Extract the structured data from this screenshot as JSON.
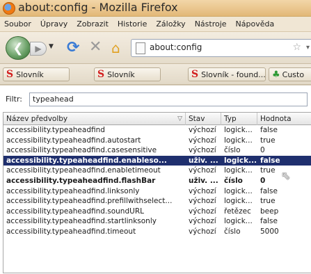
{
  "window": {
    "title": "about:config - Mozilla Firefox"
  },
  "menu": [
    "Soubor",
    "Úpravy",
    "Zobrazit",
    "Historie",
    "Záložky",
    "Nástroje",
    "Nápověda"
  ],
  "nav": {
    "url": "about:config"
  },
  "bookmarks": [
    {
      "label": "Slovník",
      "icon": "S"
    },
    {
      "label": "Slovník",
      "icon": "S"
    },
    {
      "label": "Slovník - found...",
      "icon": "S"
    },
    {
      "label": "Custo",
      "icon": "♣"
    }
  ],
  "filter": {
    "label": "Filtr:",
    "value": "typeahead"
  },
  "table": {
    "headers": [
      "Název předvolby",
      "Stav",
      "Typ",
      "Hodnota"
    ],
    "rows": [
      {
        "name": "accessibility.typeaheadfind",
        "status": "výchozí",
        "type": "logick...",
        "value": "false",
        "selected": false,
        "bold": false
      },
      {
        "name": "accessibility.typeaheadfind.autostart",
        "status": "výchozí",
        "type": "logick...",
        "value": "true",
        "selected": false,
        "bold": false
      },
      {
        "name": "accessibility.typeaheadfind.casesensitive",
        "status": "výchozí",
        "type": "číslo",
        "value": "0",
        "selected": false,
        "bold": false
      },
      {
        "name": "accessibility.typeaheadfind.enableso...",
        "status": "uživ. ...",
        "type": "logick...",
        "value": "false",
        "selected": true,
        "bold": true
      },
      {
        "name": "accessibility.typeaheadfind.enabletimeout",
        "status": "výchozí",
        "type": "logick...",
        "value": "true",
        "selected": false,
        "bold": false
      },
      {
        "name": "accessibility.typeaheadfind.flashBar",
        "status": "uživ. ...",
        "type": "číslo",
        "value": "0",
        "selected": false,
        "bold": true
      },
      {
        "name": "accessibility.typeaheadfind.linksonly",
        "status": "výchozí",
        "type": "logick...",
        "value": "false",
        "selected": false,
        "bold": false
      },
      {
        "name": "accessibility.typeaheadfind.prefillwithselect...",
        "status": "výchozí",
        "type": "logick...",
        "value": "true",
        "selected": false,
        "bold": false
      },
      {
        "name": "accessibility.typeaheadfind.soundURL",
        "status": "výchozí",
        "type": "řetězec",
        "value": "beep",
        "selected": false,
        "bold": false
      },
      {
        "name": "accessibility.typeaheadfind.startlinksonly",
        "status": "výchozí",
        "type": "logick...",
        "value": "false",
        "selected": false,
        "bold": false
      },
      {
        "name": "accessibility.typeaheadfind.timeout",
        "status": "výchozí",
        "type": "číslo",
        "value": "5000",
        "selected": false,
        "bold": false
      }
    ]
  },
  "colors": {
    "selection": "#1f2f6e",
    "titlebar": "#e9c48b"
  }
}
